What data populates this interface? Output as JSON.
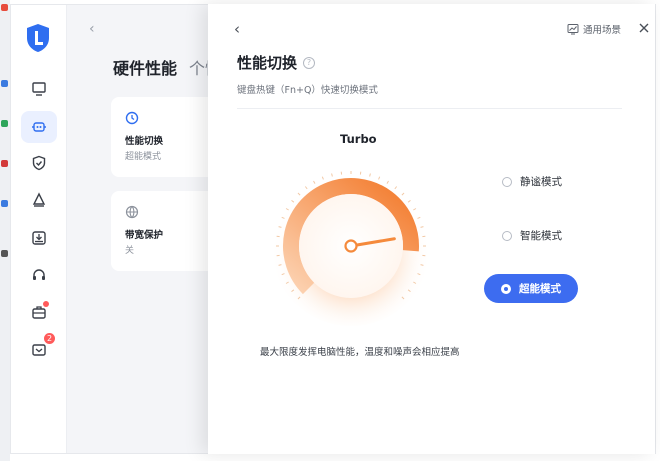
{
  "sidebar": {
    "items": [
      {
        "icon": "monitor-icon"
      },
      {
        "icon": "chip-icon",
        "active": true
      },
      {
        "icon": "shield-check-icon"
      },
      {
        "icon": "cleaner-icon"
      },
      {
        "icon": "download-box-icon"
      },
      {
        "icon": "headset-icon"
      },
      {
        "icon": "toolbox-icon",
        "dot": true
      },
      {
        "icon": "gift-icon",
        "badge": "2"
      }
    ]
  },
  "main": {
    "title": "硬件性能",
    "tab2": "个性",
    "cards": [
      {
        "title": "性能切换",
        "subtitle": "超能模式",
        "icon": "clock-icon"
      },
      {
        "title": "带宽保护",
        "subtitle": "关",
        "icon": "globe-icon"
      }
    ]
  },
  "drawer": {
    "back": "‹",
    "scene_label": "通用场景",
    "title": "性能切换",
    "help": "?",
    "subtitle": "键盘热键（Fn+Q）快速切换模式",
    "gauge_label": "Turbo",
    "gauge_level": 0.85,
    "modes": [
      "静谧模式",
      "智能模式",
      "超能模式"
    ],
    "active_mode": "超能模式",
    "description": "最大限度发挥电脑性能，温度和噪声会相应提高"
  },
  "colors": {
    "accent": "#3d6cf0",
    "gauge_orange": "#f58a3c",
    "badge_red": "#ff5a5a"
  }
}
